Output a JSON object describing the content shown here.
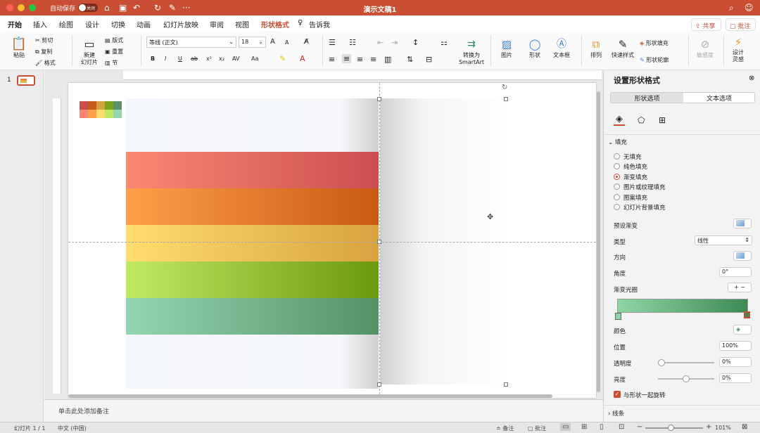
{
  "titlebar": {
    "autosave_label": "自动保存",
    "autosave_state": "关闭",
    "doc_title": "演示文稿1",
    "more": "···"
  },
  "tabs": [
    "开始",
    "插入",
    "绘图",
    "设计",
    "切换",
    "动画",
    "幻灯片放映",
    "审阅",
    "视图",
    "形状格式"
  ],
  "tell_me": "告诉我",
  "share": "共享",
  "comment": "批注",
  "ribbon": {
    "paste": "粘贴",
    "cut": "剪切",
    "copy": "复制",
    "format": "格式",
    "new_slide": "新建\n幻灯片",
    "layout": "版式",
    "reset": "重置",
    "section": "节",
    "font_name": "等线 (正文)",
    "font_size": "18",
    "bold": "B",
    "italic": "I",
    "underline": "U",
    "strike": "ab",
    "superscript": "x²",
    "subscript": "x₂",
    "char_spacing": "AV",
    "case": "Aa",
    "grow_font": "A",
    "shrink_font": "A",
    "smartart": "转换为\nSmartArt",
    "picture": "图片",
    "shape": "形状",
    "textbox": "文本框",
    "arrange": "排列",
    "quick_styles": "快速样式",
    "shape_fill": "形状填充",
    "shape_outline": "形状轮廓",
    "sensitivity": "敏感度",
    "designer": "设计\n灵感"
  },
  "slides": {
    "number": "1"
  },
  "notes_placeholder": "单击此处添加备注",
  "status": {
    "slide_info": "幻灯片 1 / 1",
    "language": "中文 (中国)",
    "notes": "备注",
    "comments": "批注",
    "zoom": "101%"
  },
  "panel": {
    "title": "设置形状格式",
    "tab_shape": "形状选项",
    "tab_text": "文本选项",
    "fill_section": "填充",
    "fill_options": [
      "无填充",
      "纯色填充",
      "渐变填充",
      "图片或纹理填充",
      "图案填充",
      "幻灯片背景填充"
    ],
    "fill_selected_index": 2,
    "preset_gradient": "预设渐变",
    "type_label": "类型",
    "type_value": "线性",
    "direction_label": "方向",
    "angle_label": "角度",
    "angle_value": "0°",
    "gradient_stops_label": "渐变光圈",
    "color_label": "颜色",
    "position_label": "位置",
    "position_value": "100%",
    "transparency_label": "透明度",
    "transparency_value": "0%",
    "transparency_level": 0,
    "brightness_label": "亮度",
    "brightness_value": "0%",
    "brightness_level": 0.5,
    "rotate_with_shape": "与形状一起旋转",
    "line_section": "线条"
  },
  "colors": {
    "accent": "#c94e33",
    "stripes": [
      [
        "#fb8873",
        "#cc4f50"
      ],
      [
        "#fda049",
        "#c95a14"
      ],
      [
        "#ffdd6e",
        "#d8a340"
      ],
      [
        "#c2e962",
        "#6b990e"
      ],
      [
        "#94d6b1",
        "#559168"
      ]
    ],
    "swatch_top": [
      "#c84d4c",
      "#c55a1a",
      "#d4a23f",
      "#79a11b",
      "#5c8f6a"
    ],
    "swatch_bottom": [
      "#f88572",
      "#fda049",
      "#fedc6d",
      "#c2e863",
      "#93d6af"
    ],
    "gradient_start": "#8fd6a6",
    "gradient_end": "#3d8a55"
  }
}
